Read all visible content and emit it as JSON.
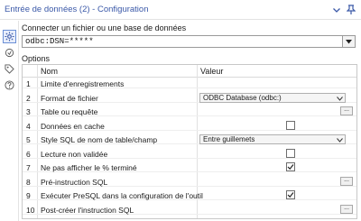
{
  "titlebar": {
    "title": "Entrée de données (2) - Configuration"
  },
  "connection": {
    "label": "Connecter un fichier ou une base de données",
    "value": "odbc:DSN=*****"
  },
  "options": {
    "label": "Options",
    "columns": {
      "name": "Nom",
      "value": "Valeur"
    },
    "rows": [
      {
        "num": "1",
        "name": "Limite d'enregistrements",
        "type": "text"
      },
      {
        "num": "2",
        "name": "Format de fichier",
        "type": "combo",
        "value": "ODBC Database (odbc:)"
      },
      {
        "num": "3",
        "name": "Table ou requête",
        "type": "ellipsis",
        "button": "..."
      },
      {
        "num": "4",
        "name": "Données en cache",
        "type": "check",
        "checked": false
      },
      {
        "num": "5",
        "name": "Style SQL de nom de table/champ",
        "type": "combo",
        "value": "Entre guillemets"
      },
      {
        "num": "6",
        "name": "Lecture non validée",
        "type": "check",
        "checked": false
      },
      {
        "num": "7",
        "name": "Ne pas afficher le % terminé",
        "type": "check",
        "checked": true
      },
      {
        "num": "8",
        "name": "Pré-instruction SQL",
        "type": "ellipsis",
        "button": "..."
      },
      {
        "num": "9",
        "name": "Exécuter PreSQL dans la configuration de l'outil",
        "type": "check",
        "checked": true
      },
      {
        "num": "10",
        "name": "Post-créer l'instruction SQL",
        "type": "ellipsis",
        "button": "..."
      }
    ]
  },
  "colors": {
    "title": "#3b59a8",
    "active_tab_border": "#6b8fd6"
  }
}
